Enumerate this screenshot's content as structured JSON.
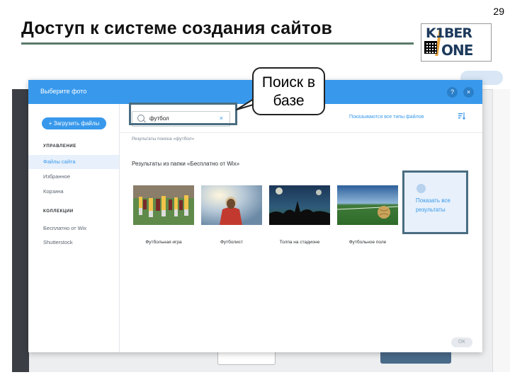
{
  "slide": {
    "number": "29",
    "title": "Доступ к системе создания сайтов",
    "logo_top": "K1BER",
    "logo_bottom": "ONE"
  },
  "dialog": {
    "title": "Выберите фото",
    "help_icon": "?",
    "close_icon": "×",
    "upload_label": "+ Загрузить файлы",
    "sections": [
      {
        "heading": "УПРАВЛЕНИЕ",
        "items": [
          "Файлы сайта",
          "Избранное",
          "Корзина"
        ]
      },
      {
        "heading": "КОЛЛЕКЦИИ",
        "items": [
          "Бесплатно от Wix",
          "Shutterstock"
        ]
      }
    ],
    "active_item": "Файлы сайта",
    "search_value": "футбол",
    "filter_label": "Показываются все типы файлов",
    "results_label": "Результаты поиска «футбол»",
    "folder_label": "Результаты из папки «Бесплатно от Wix»",
    "photos": [
      {
        "caption": "Футбольная игра",
        "icon": "football-game-photo"
      },
      {
        "caption": "Футболист",
        "icon": "football-player-photo"
      },
      {
        "caption": "Толпа на стадионе",
        "icon": "stadium-crowd-photo"
      },
      {
        "caption": "Футбольное поле",
        "icon": "football-field-photo"
      }
    ],
    "show_all_label": "Показать все результаты",
    "ok_label": "OK"
  },
  "annotation": {
    "callout_text": "Поиск в базе"
  },
  "colors": {
    "accent": "#3899ec",
    "highlight_frame": "#4a6d82"
  }
}
